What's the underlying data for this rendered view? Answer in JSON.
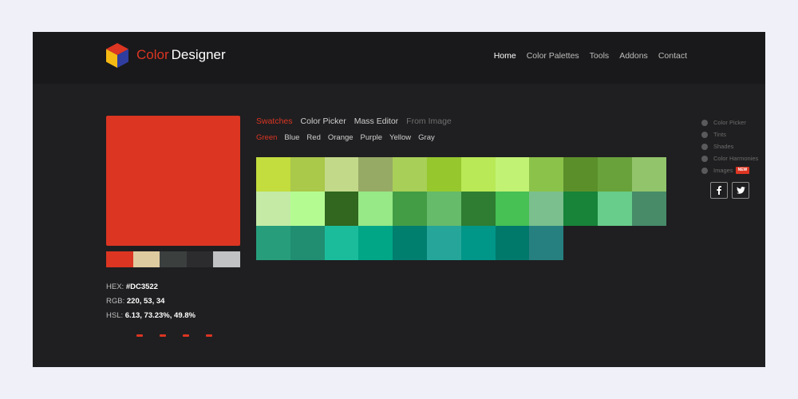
{
  "header": {
    "brand_part1": "Color",
    "brand_part2": "Designer",
    "nav": [
      "Home",
      "Color Palettes",
      "Tools",
      "Addons",
      "Contact"
    ],
    "active_nav": "Home",
    "logo_icon": "cube-logo-icon"
  },
  "selected": {
    "color": "#DC3522",
    "hex_label": "HEX:",
    "hex": "#DC3522",
    "rgb_label": "RGB:",
    "rgb": "220, 53, 34",
    "hsl_label": "HSL:",
    "hsl": "6.13, 73.23%, 49.8%"
  },
  "palette_strip": [
    "#dc3522",
    "#dfcba0",
    "#3b3f3e",
    "#2c2c2e",
    "#c0c2c4"
  ],
  "mode_tabs": [
    "Swatches",
    "Color Picker",
    "Mass Editor",
    "From Image"
  ],
  "active_mode": "Swatches",
  "color_tabs": [
    "Green",
    "Blue",
    "Red",
    "Orange",
    "Purple",
    "Yellow",
    "Gray"
  ],
  "active_color": "Green",
  "swatches": [
    "#c3dd3e",
    "#aac84a",
    "#c2d98a",
    "#97aa65",
    "#a8cf57",
    "#96c82e",
    "#b9e957",
    "#c2f274",
    "#8bc24a",
    "#5b8f2a",
    "#69a23a",
    "#92c46b",
    "#c4eaa5",
    "#b4fc92",
    "#31671f",
    "#97e886",
    "#429d45",
    "#66bb6a",
    "#2e7d32",
    "#47c054",
    "#7abf8d",
    "#178439",
    "#68cc8b",
    "#478b69",
    "#279d7b",
    "#218e71",
    "#1bbc9c",
    "#00a686",
    "#007e6e",
    "#26a69a",
    "#009688",
    "#00796b",
    "#278080"
  ],
  "side_menu": [
    {
      "label": "Color Picker"
    },
    {
      "label": "Tints"
    },
    {
      "label": "Shades"
    },
    {
      "label": "Color Harmonies"
    },
    {
      "label": "Images",
      "badge": "NEW"
    }
  ],
  "social": [
    {
      "icon": "facebook-icon"
    },
    {
      "icon": "twitter-icon"
    }
  ],
  "colors": {
    "accent": "#dc3522",
    "page_bg": "#eff0f8",
    "app_bg": "#1f1f21",
    "header_bg": "#19191b"
  }
}
